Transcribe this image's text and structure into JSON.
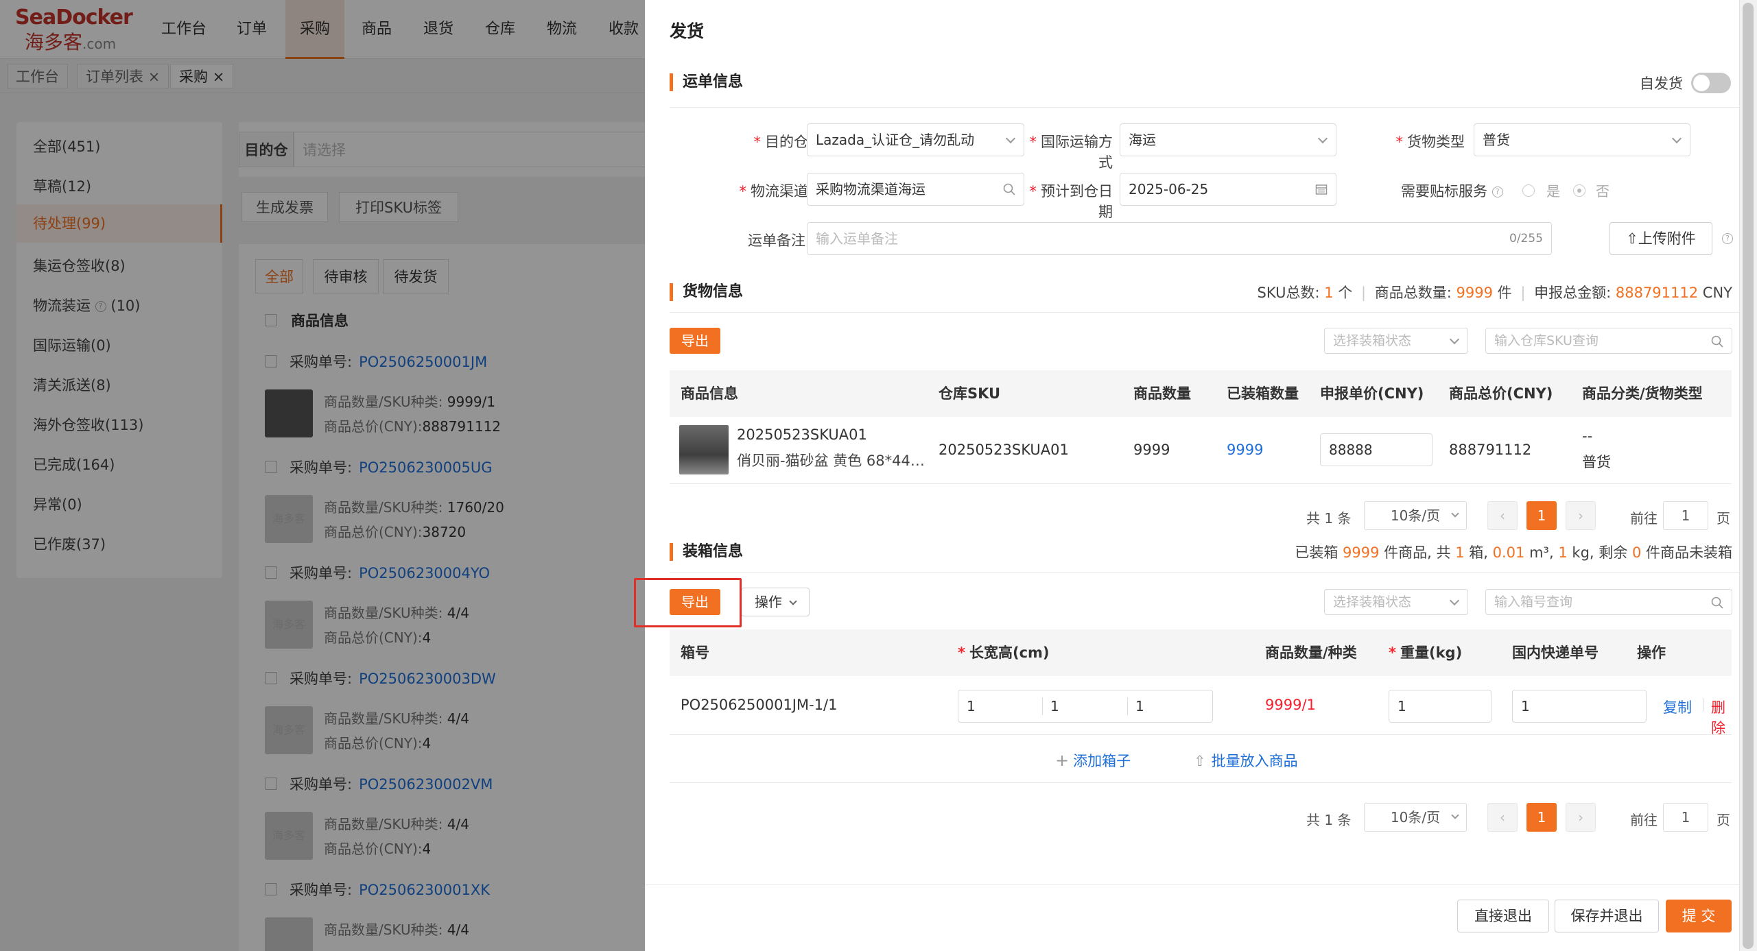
{
  "bg": {
    "logo": {
      "line1": "SeaDocker",
      "line2": "海多客",
      "suffix": ".com"
    },
    "nav": [
      "工作台",
      "订单",
      "采购",
      "商品",
      "退货",
      "仓库",
      "物流",
      "收款"
    ],
    "tabs": [
      {
        "label": "工作台"
      },
      {
        "label": "订单列表"
      },
      {
        "label": "采购"
      }
    ],
    "tab_close": "×",
    "menu": [
      "全部(451)",
      "草稿(12)",
      "待处理(99)",
      "集运仓签收(8)",
      "物流装运",
      "(10)",
      "国际运输(0)",
      "清关派送(8)",
      "海外仓签收(113)",
      "已完成(164)",
      "异常(0)",
      "已作废(37)"
    ],
    "filter": {
      "label": "目的仓",
      "placeholder": "请选择"
    },
    "actions": [
      "生成发票",
      "打印SKU标签"
    ],
    "list_tabs": [
      "全部",
      "待审核",
      "待发货"
    ],
    "list_header": "商品信息",
    "po_label": "采购单号:",
    "qty_label": "商品数量/SKU种类:",
    "total_label": "商品总价(CNY):",
    "thumb_text": "海多客",
    "orders": [
      {
        "no": "PO2506250001JM",
        "qty": "9999/1",
        "total": "888791112"
      },
      {
        "no": "PO2506230005UG",
        "qty": "1760/20",
        "total": "38720"
      },
      {
        "no": "PO2506230004YO",
        "qty": "4/4",
        "total": "4"
      },
      {
        "no": "PO2506230003DW",
        "qty": "4/4",
        "total": "4"
      },
      {
        "no": "PO2506230002VM",
        "qty": "4/4",
        "total": "4"
      },
      {
        "no": "PO2506230001XK",
        "qty": "4/4",
        "total": ""
      }
    ]
  },
  "drawer": {
    "title": "发货",
    "waybill": {
      "section": "运单信息",
      "self_ship": "自发货",
      "dest_label": "目的仓",
      "dest_value": "Lazada_认证仓_请勿乱动",
      "intl_label": "国际运输方式",
      "intl_value": "海运",
      "cargo_label": "货物类型",
      "cargo_value": "普货",
      "channel_label": "物流渠道",
      "channel_value": "采购物流渠道海运",
      "eta_label": "预计到仓日期",
      "eta_value": "2025-06-25",
      "label_service": "需要贴标服务",
      "yes": "是",
      "no": "否",
      "remark_label": "运单备注",
      "remark_placeholder": "输入运单备注",
      "remark_count": "0/255",
      "upload": "上传附件"
    },
    "goods": {
      "section": "货物信息",
      "sku_total_label": "SKU总数:",
      "sku_total": "1",
      "sku_unit": "个",
      "qty_total_label": "商品总数量:",
      "qty_total": "9999",
      "qty_unit": "件",
      "amount_label": "申报总金额:",
      "amount": "888791112",
      "currency": "CNY",
      "export": "导出",
      "box_status_placeholder": "选择装箱状态",
      "sku_search_placeholder": "输入仓库SKU查询",
      "columns": [
        "商品信息",
        "仓库SKU",
        "商品数量",
        "已装箱数量",
        "申报单价(CNY)",
        "商品总价(CNY)",
        "商品分类/货物类型"
      ],
      "row": {
        "sku_code": "20250523SKUA01",
        "name": "俏贝丽-猫砂盆 黄色 68*44…",
        "warehouse_sku": "20250523SKUA01",
        "qty": "9999",
        "boxed": "9999",
        "unit_price": "88888",
        "total": "888791112",
        "category": "--",
        "cargo": "普货"
      }
    },
    "pager": {
      "total": "共 1 条",
      "size": "10条/页",
      "current": "1",
      "goto": "前往",
      "goto_value": "1",
      "page": "页",
      "prev": "‹",
      "next": "›"
    },
    "packing": {
      "section": "装箱信息",
      "summary": {
        "p1": "已装箱",
        "items": "9999",
        "p2": "件商品,  共",
        "boxes": "1",
        "p3": "箱,",
        "vol": "0.01",
        "p4": "m³,",
        "weight": "1",
        "p5": "kg, 剩余",
        "left": "0",
        "p6": "件商品未装箱"
      },
      "export": "导出",
      "ops": "操作",
      "box_status_placeholder": "选择装箱状态",
      "box_search_placeholder": "输入箱号查询",
      "columns": [
        "箱号",
        "长宽高(cm)",
        "商品数量/种类",
        "重量(kg)",
        "国内快递单号",
        "操作"
      ],
      "row": {
        "box_no": "PO2506250001JM-1/1",
        "l": "1",
        "w": "1",
        "h": "1",
        "qty": "9999/1",
        "weight": "1",
        "express": "1",
        "copy": "复制",
        "delete": "删除"
      },
      "add_box": "添加箱子",
      "batch": "批量放入商品"
    },
    "footer": {
      "exit": "直接退出",
      "save_exit": "保存并退出",
      "submit": "提 交"
    }
  },
  "colors": {
    "accent": "#f27021",
    "link": "#1e6fd9",
    "danger": "#f5222d",
    "highlight": "#e1302a"
  }
}
